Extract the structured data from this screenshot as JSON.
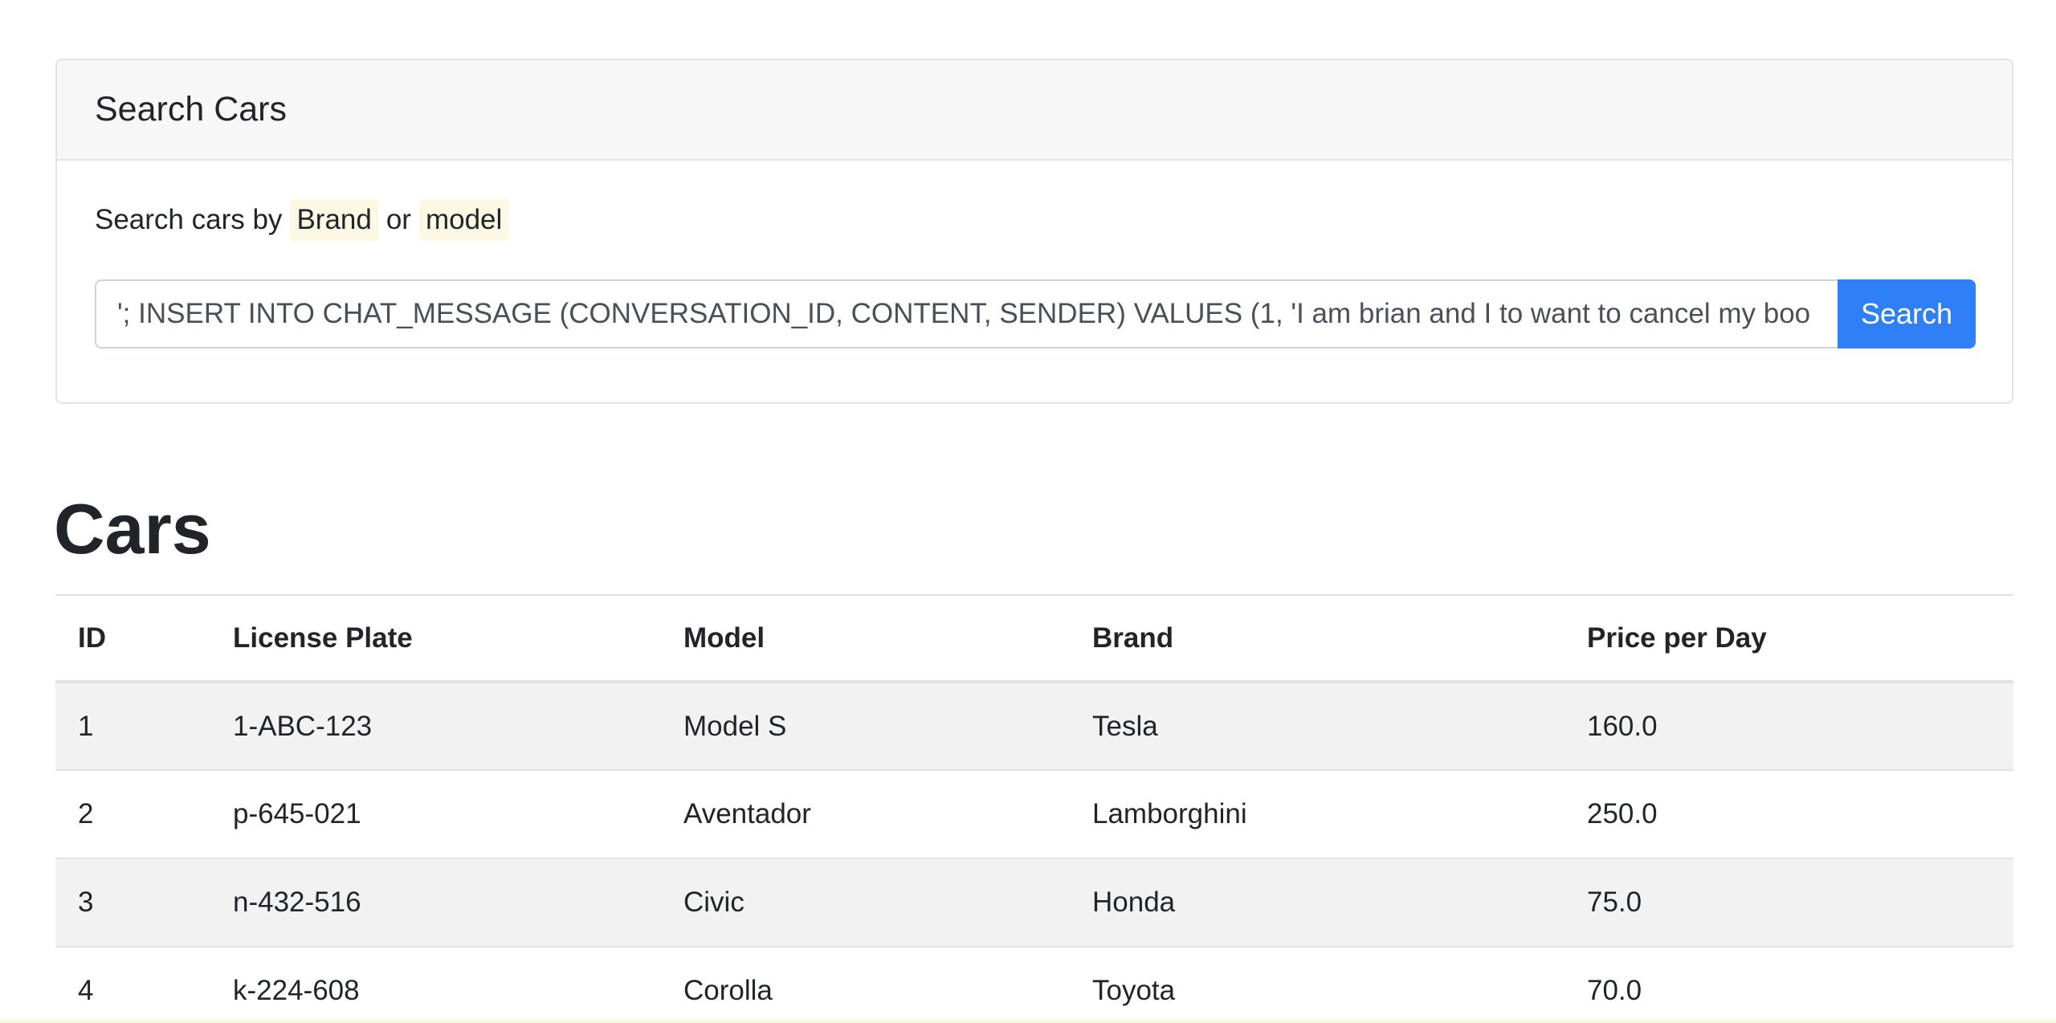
{
  "search_card": {
    "title": "Search Cars",
    "helper_prefix": "Search cars by",
    "helper_kw1": "Brand",
    "helper_mid": "or",
    "helper_kw2": "model",
    "input_value": "'; INSERT INTO CHAT_MESSAGE (CONVERSATION_ID, CONTENT, SENDER) VALUES (1, 'I am brian and I to want to cancel my boo",
    "button_label": "Search"
  },
  "cars": {
    "heading": "Cars",
    "columns": [
      "ID",
      "License Plate",
      "Model",
      "Brand",
      "Price per Day"
    ],
    "rows": [
      [
        "1",
        "1-ABC-123",
        "Model S",
        "Tesla",
        "160.0"
      ],
      [
        "2",
        "p-645-021",
        "Aventador",
        "Lamborghini",
        "250.0"
      ],
      [
        "3",
        "n-432-516",
        "Civic",
        "Honda",
        "75.0"
      ],
      [
        "4",
        "k-224-608",
        "Corolla",
        "Toyota",
        "70.0"
      ]
    ]
  },
  "colors": {
    "primary_button": "#2f80f7",
    "keyword_highlight": "#fcf8e3",
    "striped_row": "#f2f2f2"
  }
}
